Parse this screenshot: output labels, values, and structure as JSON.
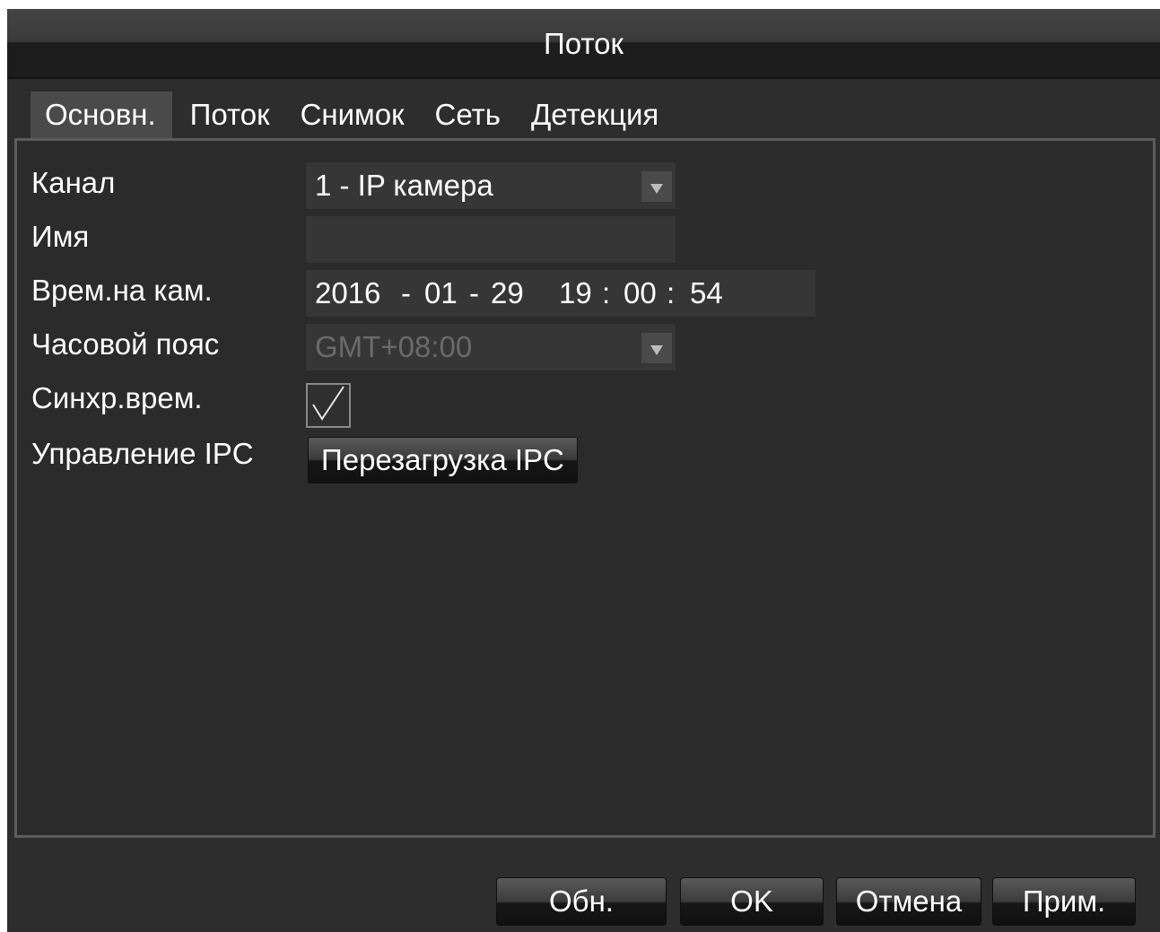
{
  "window": {
    "title": "Поток"
  },
  "tabs": [
    {
      "label": "Основн.",
      "active": true
    },
    {
      "label": "Поток",
      "active": false
    },
    {
      "label": "Снимок",
      "active": false
    },
    {
      "label": "Сеть",
      "active": false
    },
    {
      "label": "Детекция",
      "active": false
    }
  ],
  "form": {
    "channel": {
      "label": "Канал",
      "value": "1 - IP камера"
    },
    "name": {
      "label": "Имя",
      "value": ""
    },
    "camera_time": {
      "label": "Врем.на кам.",
      "year": "2016",
      "sep1": "-",
      "month": "01",
      "sep2": "-",
      "day": "29",
      "hour": "19",
      "colon1": ":",
      "minute": "00",
      "colon2": ":",
      "second": "54"
    },
    "timezone": {
      "label": "Часовой пояс",
      "value": "GMT+08:00",
      "disabled": true
    },
    "sync_time": {
      "label": "Синхр.врем.",
      "checked": true
    },
    "ipc_control": {
      "label": "Управление IPC",
      "button_label": "Перезагрузка IPC"
    }
  },
  "footer": {
    "refresh_label": "Обн.",
    "ok_label": "OK",
    "cancel_label": "Отмена",
    "apply_label": "Прим."
  },
  "colors": {
    "background": "#2d2d2d",
    "panel_border": "#5c5c5c",
    "field_bg": "#363636",
    "active_tab_bg": "#4a4a4a",
    "text": "#ffffff",
    "disabled_text": "#6a6a6a"
  },
  "icons": {
    "dropdown": "chevron-down-icon",
    "checkbox": "checkmark-icon"
  }
}
